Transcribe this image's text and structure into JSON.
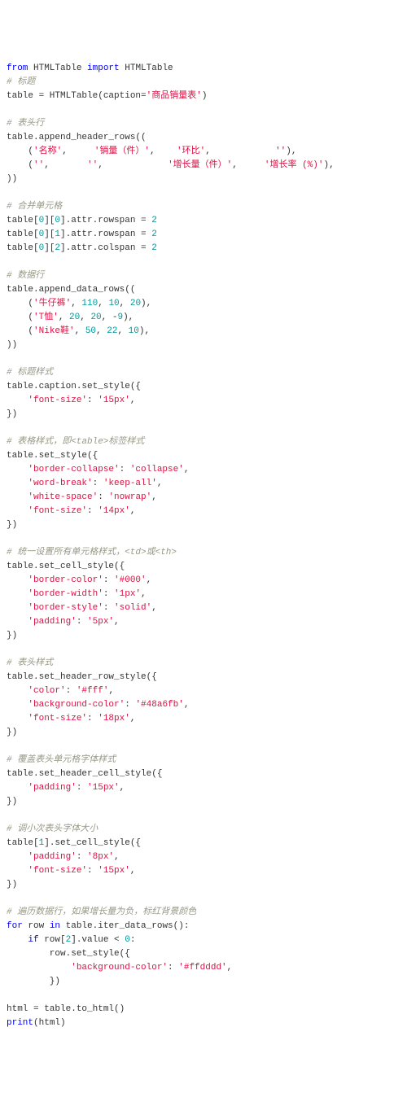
{
  "lines": [
    [
      {
        "c": "kw",
        "t": "from"
      },
      {
        "c": "pu",
        "t": " HTMLTable "
      },
      {
        "c": "kw",
        "t": "import"
      },
      {
        "c": "pu",
        "t": " HTMLTable"
      }
    ],
    [
      {
        "c": "cm",
        "t": "# 标题"
      }
    ],
    [
      {
        "c": "pu",
        "t": "table = HTMLTable(caption="
      },
      {
        "c": "st",
        "t": "'商品销量表'"
      },
      {
        "c": "pu",
        "t": ")"
      }
    ],
    [],
    [
      {
        "c": "cm",
        "t": "# 表头行"
      }
    ],
    [
      {
        "c": "pu",
        "t": "table.append_header_rows(("
      }
    ],
    [
      {
        "c": "pu",
        "t": "    ("
      },
      {
        "c": "st",
        "t": "'名称'"
      },
      {
        "c": "pu",
        "t": ",     "
      },
      {
        "c": "st",
        "t": "'销量（件）'"
      },
      {
        "c": "pu",
        "t": ",    "
      },
      {
        "c": "st",
        "t": "'环比'"
      },
      {
        "c": "pu",
        "t": ",            "
      },
      {
        "c": "st",
        "t": "''"
      },
      {
        "c": "pu",
        "t": "),"
      }
    ],
    [
      {
        "c": "pu",
        "t": "    ("
      },
      {
        "c": "st",
        "t": "''"
      },
      {
        "c": "pu",
        "t": ",       "
      },
      {
        "c": "st",
        "t": "''"
      },
      {
        "c": "pu",
        "t": ",            "
      },
      {
        "c": "st",
        "t": "'增长量（件）'"
      },
      {
        "c": "pu",
        "t": ",     "
      },
      {
        "c": "st",
        "t": "'增长率 (%)'"
      },
      {
        "c": "pu",
        "t": "),"
      }
    ],
    [
      {
        "c": "pu",
        "t": "))"
      }
    ],
    [],
    [
      {
        "c": "cm",
        "t": "# 合并单元格"
      }
    ],
    [
      {
        "c": "pu",
        "t": "table["
      },
      {
        "c": "nm",
        "t": "0"
      },
      {
        "c": "pu",
        "t": "]["
      },
      {
        "c": "nm",
        "t": "0"
      },
      {
        "c": "pu",
        "t": "].attr.rowspan = "
      },
      {
        "c": "nm",
        "t": "2"
      }
    ],
    [
      {
        "c": "pu",
        "t": "table["
      },
      {
        "c": "nm",
        "t": "0"
      },
      {
        "c": "pu",
        "t": "]["
      },
      {
        "c": "nm",
        "t": "1"
      },
      {
        "c": "pu",
        "t": "].attr.rowspan = "
      },
      {
        "c": "nm",
        "t": "2"
      }
    ],
    [
      {
        "c": "pu",
        "t": "table["
      },
      {
        "c": "nm",
        "t": "0"
      },
      {
        "c": "pu",
        "t": "]["
      },
      {
        "c": "nm",
        "t": "2"
      },
      {
        "c": "pu",
        "t": "].attr.colspan = "
      },
      {
        "c": "nm",
        "t": "2"
      }
    ],
    [],
    [
      {
        "c": "cm",
        "t": "# 数据行"
      }
    ],
    [
      {
        "c": "pu",
        "t": "table.append_data_rows(("
      }
    ],
    [
      {
        "c": "pu",
        "t": "    ("
      },
      {
        "c": "st",
        "t": "'牛仔裤'"
      },
      {
        "c": "pu",
        "t": ", "
      },
      {
        "c": "nm",
        "t": "110"
      },
      {
        "c": "pu",
        "t": ", "
      },
      {
        "c": "nm",
        "t": "10"
      },
      {
        "c": "pu",
        "t": ", "
      },
      {
        "c": "nm",
        "t": "20"
      },
      {
        "c": "pu",
        "t": "),"
      }
    ],
    [
      {
        "c": "pu",
        "t": "    ("
      },
      {
        "c": "st",
        "t": "'T恤'"
      },
      {
        "c": "pu",
        "t": ", "
      },
      {
        "c": "nm",
        "t": "20"
      },
      {
        "c": "pu",
        "t": ", "
      },
      {
        "c": "nm",
        "t": "20"
      },
      {
        "c": "pu",
        "t": ", -"
      },
      {
        "c": "nm",
        "t": "9"
      },
      {
        "c": "pu",
        "t": "),"
      }
    ],
    [
      {
        "c": "pu",
        "t": "    ("
      },
      {
        "c": "st",
        "t": "'Nike鞋'"
      },
      {
        "c": "pu",
        "t": ", "
      },
      {
        "c": "nm",
        "t": "50"
      },
      {
        "c": "pu",
        "t": ", "
      },
      {
        "c": "nm",
        "t": "22"
      },
      {
        "c": "pu",
        "t": ", "
      },
      {
        "c": "nm",
        "t": "10"
      },
      {
        "c": "pu",
        "t": "),"
      }
    ],
    [
      {
        "c": "pu",
        "t": "))"
      }
    ],
    [],
    [
      {
        "c": "cm",
        "t": "# 标题样式"
      }
    ],
    [
      {
        "c": "pu",
        "t": "table.caption.set_style({"
      }
    ],
    [
      {
        "c": "pu",
        "t": "    "
      },
      {
        "c": "st",
        "t": "'font-size'"
      },
      {
        "c": "pu",
        "t": ": "
      },
      {
        "c": "st",
        "t": "'15px'"
      },
      {
        "c": "pu",
        "t": ","
      }
    ],
    [
      {
        "c": "pu",
        "t": "})"
      }
    ],
    [],
    [
      {
        "c": "cm",
        "t": "# 表格样式，即<table>标签样式"
      }
    ],
    [
      {
        "c": "pu",
        "t": "table.set_style({"
      }
    ],
    [
      {
        "c": "pu",
        "t": "    "
      },
      {
        "c": "st",
        "t": "'border-collapse'"
      },
      {
        "c": "pu",
        "t": ": "
      },
      {
        "c": "st",
        "t": "'collapse'"
      },
      {
        "c": "pu",
        "t": ","
      }
    ],
    [
      {
        "c": "pu",
        "t": "    "
      },
      {
        "c": "st",
        "t": "'word-break'"
      },
      {
        "c": "pu",
        "t": ": "
      },
      {
        "c": "st",
        "t": "'keep-all'"
      },
      {
        "c": "pu",
        "t": ","
      }
    ],
    [
      {
        "c": "pu",
        "t": "    "
      },
      {
        "c": "st",
        "t": "'white-space'"
      },
      {
        "c": "pu",
        "t": ": "
      },
      {
        "c": "st",
        "t": "'nowrap'"
      },
      {
        "c": "pu",
        "t": ","
      }
    ],
    [
      {
        "c": "pu",
        "t": "    "
      },
      {
        "c": "st",
        "t": "'font-size'"
      },
      {
        "c": "pu",
        "t": ": "
      },
      {
        "c": "st",
        "t": "'14px'"
      },
      {
        "c": "pu",
        "t": ","
      }
    ],
    [
      {
        "c": "pu",
        "t": "})"
      }
    ],
    [],
    [
      {
        "c": "cm",
        "t": "# 统一设置所有单元格样式，<td>或<th>"
      }
    ],
    [
      {
        "c": "pu",
        "t": "table.set_cell_style({"
      }
    ],
    [
      {
        "c": "pu",
        "t": "    "
      },
      {
        "c": "st",
        "t": "'border-color'"
      },
      {
        "c": "pu",
        "t": ": "
      },
      {
        "c": "st",
        "t": "'#000'"
      },
      {
        "c": "pu",
        "t": ","
      }
    ],
    [
      {
        "c": "pu",
        "t": "    "
      },
      {
        "c": "st",
        "t": "'border-width'"
      },
      {
        "c": "pu",
        "t": ": "
      },
      {
        "c": "st",
        "t": "'1px'"
      },
      {
        "c": "pu",
        "t": ","
      }
    ],
    [
      {
        "c": "pu",
        "t": "    "
      },
      {
        "c": "st",
        "t": "'border-style'"
      },
      {
        "c": "pu",
        "t": ": "
      },
      {
        "c": "st",
        "t": "'solid'"
      },
      {
        "c": "pu",
        "t": ","
      }
    ],
    [
      {
        "c": "pu",
        "t": "    "
      },
      {
        "c": "st",
        "t": "'padding'"
      },
      {
        "c": "pu",
        "t": ": "
      },
      {
        "c": "st",
        "t": "'5px'"
      },
      {
        "c": "pu",
        "t": ","
      }
    ],
    [
      {
        "c": "pu",
        "t": "})"
      }
    ],
    [],
    [
      {
        "c": "cm",
        "t": "# 表头样式"
      }
    ],
    [
      {
        "c": "pu",
        "t": "table.set_header_row_style({"
      }
    ],
    [
      {
        "c": "pu",
        "t": "    "
      },
      {
        "c": "st",
        "t": "'color'"
      },
      {
        "c": "pu",
        "t": ": "
      },
      {
        "c": "st",
        "t": "'#fff'"
      },
      {
        "c": "pu",
        "t": ","
      }
    ],
    [
      {
        "c": "pu",
        "t": "    "
      },
      {
        "c": "st",
        "t": "'background-color'"
      },
      {
        "c": "pu",
        "t": ": "
      },
      {
        "c": "st",
        "t": "'#48a6fb'"
      },
      {
        "c": "pu",
        "t": ","
      }
    ],
    [
      {
        "c": "pu",
        "t": "    "
      },
      {
        "c": "st",
        "t": "'font-size'"
      },
      {
        "c": "pu",
        "t": ": "
      },
      {
        "c": "st",
        "t": "'18px'"
      },
      {
        "c": "pu",
        "t": ","
      }
    ],
    [
      {
        "c": "pu",
        "t": "})"
      }
    ],
    [],
    [
      {
        "c": "cm",
        "t": "# 覆盖表头单元格字体样式"
      }
    ],
    [
      {
        "c": "pu",
        "t": "table.set_header_cell_style({"
      }
    ],
    [
      {
        "c": "pu",
        "t": "    "
      },
      {
        "c": "st",
        "t": "'padding'"
      },
      {
        "c": "pu",
        "t": ": "
      },
      {
        "c": "st",
        "t": "'15px'"
      },
      {
        "c": "pu",
        "t": ","
      }
    ],
    [
      {
        "c": "pu",
        "t": "})"
      }
    ],
    [],
    [
      {
        "c": "cm",
        "t": "# 调小次表头字体大小"
      }
    ],
    [
      {
        "c": "pu",
        "t": "table["
      },
      {
        "c": "nm",
        "t": "1"
      },
      {
        "c": "pu",
        "t": "].set_cell_style({"
      }
    ],
    [
      {
        "c": "pu",
        "t": "    "
      },
      {
        "c": "st",
        "t": "'padding'"
      },
      {
        "c": "pu",
        "t": ": "
      },
      {
        "c": "st",
        "t": "'8px'"
      },
      {
        "c": "pu",
        "t": ","
      }
    ],
    [
      {
        "c": "pu",
        "t": "    "
      },
      {
        "c": "st",
        "t": "'font-size'"
      },
      {
        "c": "pu",
        "t": ": "
      },
      {
        "c": "st",
        "t": "'15px'"
      },
      {
        "c": "pu",
        "t": ","
      }
    ],
    [
      {
        "c": "pu",
        "t": "})"
      }
    ],
    [],
    [
      {
        "c": "cm",
        "t": "# 遍历数据行，如果增长量为负，标红背景颜色"
      }
    ],
    [
      {
        "c": "kw",
        "t": "for"
      },
      {
        "c": "pu",
        "t": " row "
      },
      {
        "c": "kw",
        "t": "in"
      },
      {
        "c": "pu",
        "t": " table.iter_data_rows():"
      }
    ],
    [
      {
        "c": "pu",
        "t": "    "
      },
      {
        "c": "kw",
        "t": "if"
      },
      {
        "c": "pu",
        "t": " row["
      },
      {
        "c": "nm",
        "t": "2"
      },
      {
        "c": "pu",
        "t": "].value < "
      },
      {
        "c": "nm",
        "t": "0"
      },
      {
        "c": "pu",
        "t": ":"
      }
    ],
    [
      {
        "c": "pu",
        "t": "        row.set_style({"
      }
    ],
    [
      {
        "c": "pu",
        "t": "            "
      },
      {
        "c": "st",
        "t": "'background-color'"
      },
      {
        "c": "pu",
        "t": ": "
      },
      {
        "c": "st",
        "t": "'#ffdddd'"
      },
      {
        "c": "pu",
        "t": ","
      }
    ],
    [
      {
        "c": "pu",
        "t": "        })"
      }
    ],
    [],
    [
      {
        "c": "pu",
        "t": "html = table.to_html()"
      }
    ],
    [
      {
        "c": "kw",
        "t": "print"
      },
      {
        "c": "pu",
        "t": "(html)"
      }
    ]
  ]
}
